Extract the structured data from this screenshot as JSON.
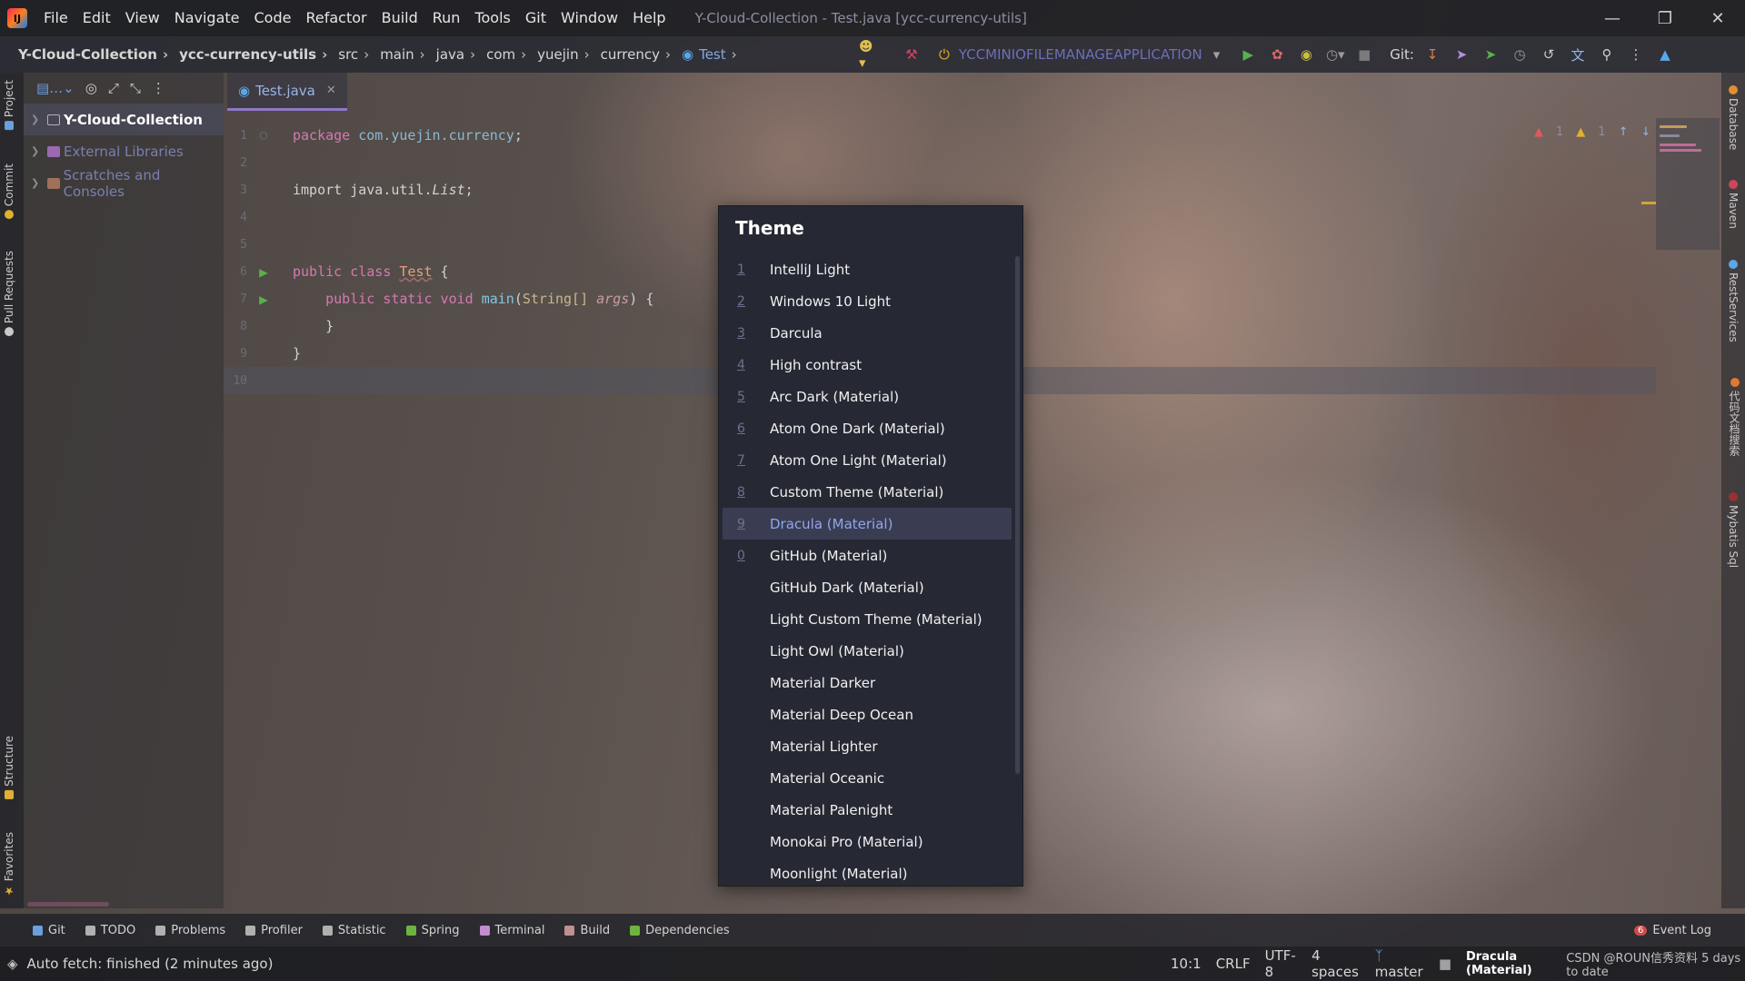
{
  "window": {
    "title": "Y-Cloud-Collection - Test.java [ycc-currency-utils]",
    "menu": [
      "File",
      "Edit",
      "View",
      "Navigate",
      "Code",
      "Refactor",
      "Build",
      "Run",
      "Tools",
      "Git",
      "Window",
      "Help"
    ]
  },
  "breadcrumbs": [
    "Y-Cloud-Collection",
    "ycc-currency-utils",
    "src",
    "main",
    "java",
    "com",
    "yuejin",
    "currency",
    "Test"
  ],
  "toolbar": {
    "run_config": "YCCMINIOFILEMANAGEAPPLICATION",
    "git_label": "Git:"
  },
  "left_tool_windows": {
    "project": "Project",
    "commit": "Commit",
    "pull_requests": "Pull Requests",
    "structure": "Structure",
    "favorites": "Favorites"
  },
  "right_tool_windows": {
    "database": "Database",
    "maven": "Maven",
    "rest_services": "RestServices",
    "doc_search": "代码文档搜索",
    "mybatis_sql": "Mybatis Sql"
  },
  "project_tree": {
    "root": "Y-Cloud-Collection",
    "external": "External Libraries",
    "scratches": "Scratches and Consoles"
  },
  "editor": {
    "tab": "Test.java",
    "line_numbers": [
      "1",
      "2",
      "3",
      "4",
      "5",
      "6",
      "7",
      "8",
      "9",
      "10"
    ],
    "code": {
      "l1_kw": "package",
      "l1_pkg": "com.yuejin.currency",
      "l1_end": ";",
      "l3": "import java.util.",
      "l3_cls": "List",
      "l3_end": ";",
      "l6_kw": "public class ",
      "l6_cls": "Test",
      "l6_end": " {",
      "l7_kw": "public static void ",
      "l7_fn": "main",
      "l7_open": "(",
      "l7_type": "String[] ",
      "l7_param": "args",
      "l7_end": ") {",
      "l8": "}",
      "l9": "}"
    },
    "inspections": {
      "errors": "1",
      "warnings": "1"
    }
  },
  "theme_popup": {
    "title": "Theme",
    "selected_index": 8,
    "items": [
      {
        "num": "1",
        "name": "IntelliJ Light"
      },
      {
        "num": "2",
        "name": "Windows 10 Light"
      },
      {
        "num": "3",
        "name": "Darcula"
      },
      {
        "num": "4",
        "name": "High contrast"
      },
      {
        "num": "5",
        "name": "Arc Dark (Material)"
      },
      {
        "num": "6",
        "name": "Atom One Dark (Material)"
      },
      {
        "num": "7",
        "name": "Atom One Light (Material)"
      },
      {
        "num": "8",
        "name": "Custom Theme (Material)"
      },
      {
        "num": "9",
        "name": "Dracula (Material)"
      },
      {
        "num": "0",
        "name": "GitHub (Material)"
      },
      {
        "num": "",
        "name": "GitHub Dark (Material)"
      },
      {
        "num": "",
        "name": "Light Custom Theme (Material)"
      },
      {
        "num": "",
        "name": "Light Owl (Material)"
      },
      {
        "num": "",
        "name": "Material Darker"
      },
      {
        "num": "",
        "name": "Material Deep Ocean"
      },
      {
        "num": "",
        "name": "Material Lighter"
      },
      {
        "num": "",
        "name": "Material Oceanic"
      },
      {
        "num": "",
        "name": "Material Palenight"
      },
      {
        "num": "",
        "name": "Monokai Pro (Material)"
      },
      {
        "num": "",
        "name": "Moonlight (Material)"
      }
    ]
  },
  "bottom_tools": [
    {
      "label": "Git",
      "icon": "git-branch-icon",
      "color": "#6a9fe0"
    },
    {
      "label": "TODO",
      "icon": "todo-icon",
      "color": "#b0b0b0"
    },
    {
      "label": "Problems",
      "icon": "problems-icon",
      "color": "#b0b0b0"
    },
    {
      "label": "Profiler",
      "icon": "profiler-icon",
      "color": "#b0b0b0"
    },
    {
      "label": "Statistic",
      "icon": "statistic-icon",
      "color": "#b0b0b0"
    },
    {
      "label": "Spring",
      "icon": "spring-icon",
      "color": "#6db33f"
    },
    {
      "label": "Terminal",
      "icon": "terminal-icon",
      "color": "#c48bd0"
    },
    {
      "label": "Build",
      "icon": "build-icon",
      "color": "#c09090"
    },
    {
      "label": "Dependencies",
      "icon": "dependencies-icon",
      "color": "#6db33f"
    }
  ],
  "event_log": {
    "count": "6",
    "label": "Event Log"
  },
  "status": {
    "message": "Auto fetch: finished (2 minutes ago)",
    "position": "10:1",
    "line_sep": "CRLF",
    "encoding": "UTF-8",
    "indent": "4 spaces",
    "branch": "master",
    "theme": "Dracula (Material)",
    "watermark": "CSDN @ROUN信秀资料 5 days to date"
  },
  "colors": {
    "accent": "#8e78c7",
    "selected_text": "#8fa7ea",
    "popup_bg": "#262833"
  }
}
